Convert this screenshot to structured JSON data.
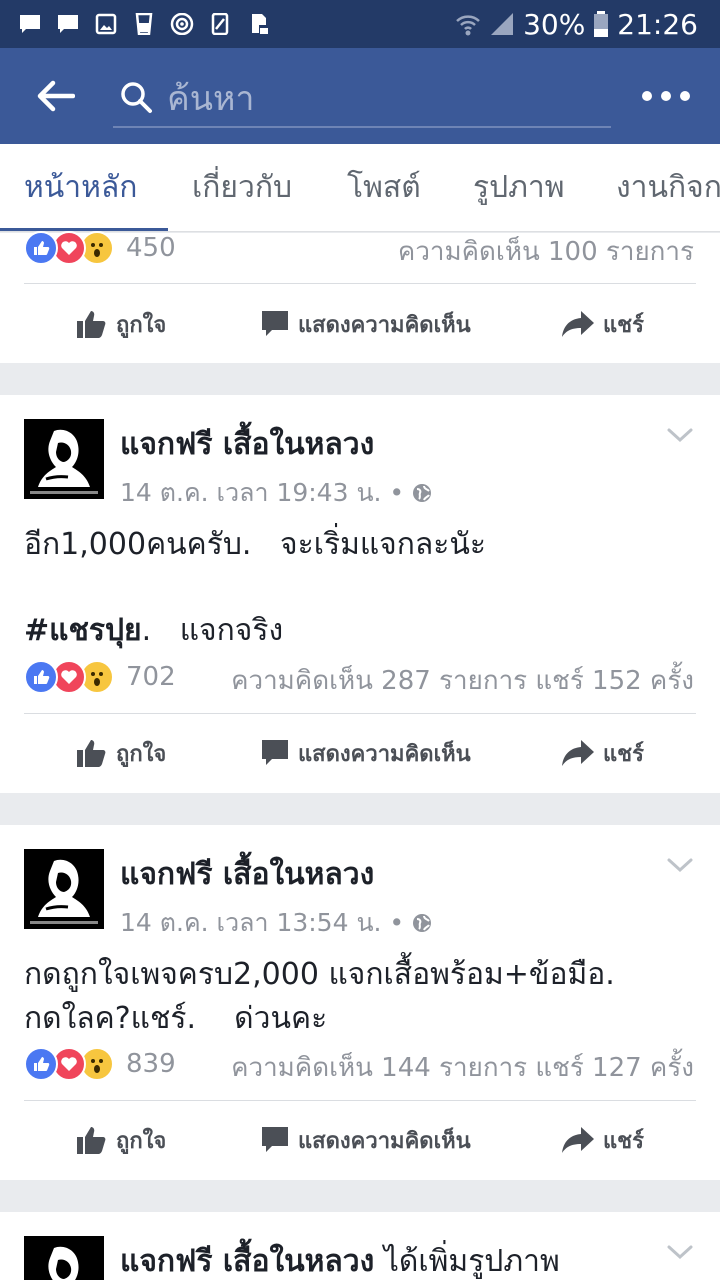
{
  "status_bar": {
    "battery": "30%",
    "time": "21:26"
  },
  "search": {
    "placeholder": "ค้นหา"
  },
  "tabs": [
    {
      "label": "หน้าหลัก",
      "active": true
    },
    {
      "label": "เกี่ยวกับ"
    },
    {
      "label": "โพสต์"
    },
    {
      "label": "รูปภาพ"
    },
    {
      "label": "งานกิจกรรม"
    }
  ],
  "actions": {
    "like": "ถูกใจ",
    "comment": "แสดงความคิดเห็น",
    "share": "แชร์"
  },
  "top_card": {
    "reaction_count": "450",
    "meta": "ความคิดเห็น 100 รายการ"
  },
  "posts": [
    {
      "page_name": "แจกฟรี เสื้อในหลวง",
      "timestamp": "14 ต.ค. เวลา 19:43 น. •",
      "text_line1": "อีก1,000คนครับ.   จะเริ่มแจกละนัะ",
      "hashtag": "#แชรปุย",
      "text_line2_rest": ".   แจกจริง",
      "reaction_count": "702",
      "meta": "ความคิดเห็น 287 รายการ แชร์ 152 ครั้ง"
    },
    {
      "page_name": "แจกฟรี เสื้อในหลวง",
      "timestamp": "14 ต.ค. เวลา 13:54 น. •",
      "text_line1": "กดถูกใจเพจครบ2,000 แจกเสื้อพร้อม+ข้อมือ.",
      "text_line2": "กดใลค?แชร์.    ด่วนคะ",
      "reaction_count": "839",
      "meta": "ความคิดเห็น 144 รายการ แชร์ 127 ครั้ง"
    },
    {
      "page_name": "แจกฟรี เสื้อในหลวง",
      "suffix": " ได้เพิ่มรูปภาพ"
    }
  ],
  "colors": {
    "brand": "#3b5998",
    "status_bar": "#233a67",
    "like": "#4b78f2",
    "love": "#f0455b",
    "wow": "#f7c63f"
  }
}
